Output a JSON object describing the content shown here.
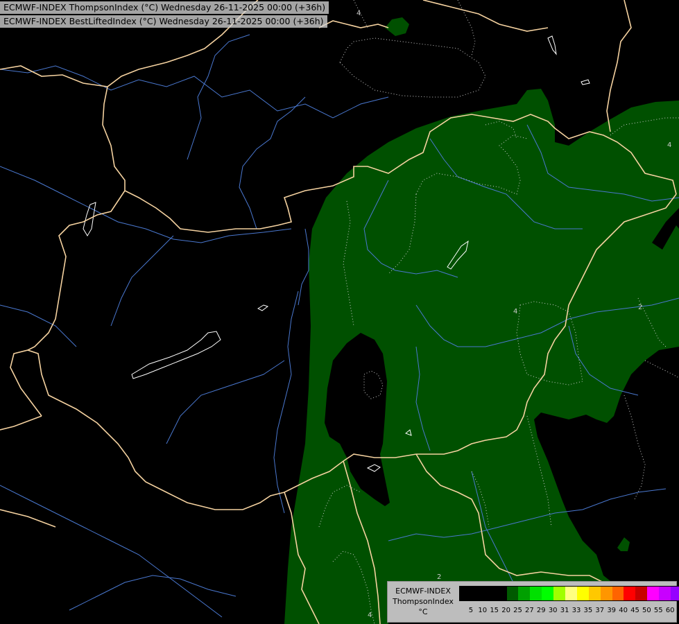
{
  "header": {
    "line1": "ECMWF-INDEX ThompsonIndex (°C) Wednesday 26-11-2025 00:00 (+36h)",
    "line2": "ECMWF-INDEX BestLiftedIndex (°C) Wednesday 26-11-2025 00:00 (+36h)"
  },
  "legend": {
    "title_line1": "ECMWF-INDEX",
    "title_line2": "ThompsonIndex",
    "title_line3": "°C",
    "colors": [
      "#000000",
      "#000000",
      "#000000",
      "#000000",
      "#005a00",
      "#00a000",
      "#00e000",
      "#00ff00",
      "#a0ff00",
      "#ffff80",
      "#ffff00",
      "#ffc800",
      "#ff9600",
      "#ff6400",
      "#ff0000",
      "#c80000",
      "#ff00ff",
      "#c800ff",
      "#9600ff",
      "#6400ff",
      "#0000ff"
    ],
    "ticks": [
      "5",
      "10",
      "15",
      "20",
      "25",
      "27",
      "29",
      "30",
      "31",
      "33",
      "35",
      "37",
      "39",
      "40",
      "45",
      "50",
      "55",
      "60"
    ]
  },
  "contour_labels": [
    "4",
    "4",
    "2",
    "4",
    "2",
    "4"
  ],
  "colors": {
    "background": "#000000",
    "positive_area": "#005000",
    "borders": "#f5d2a0",
    "rivers": "#4a78d0",
    "contours": "#cccccc"
  }
}
